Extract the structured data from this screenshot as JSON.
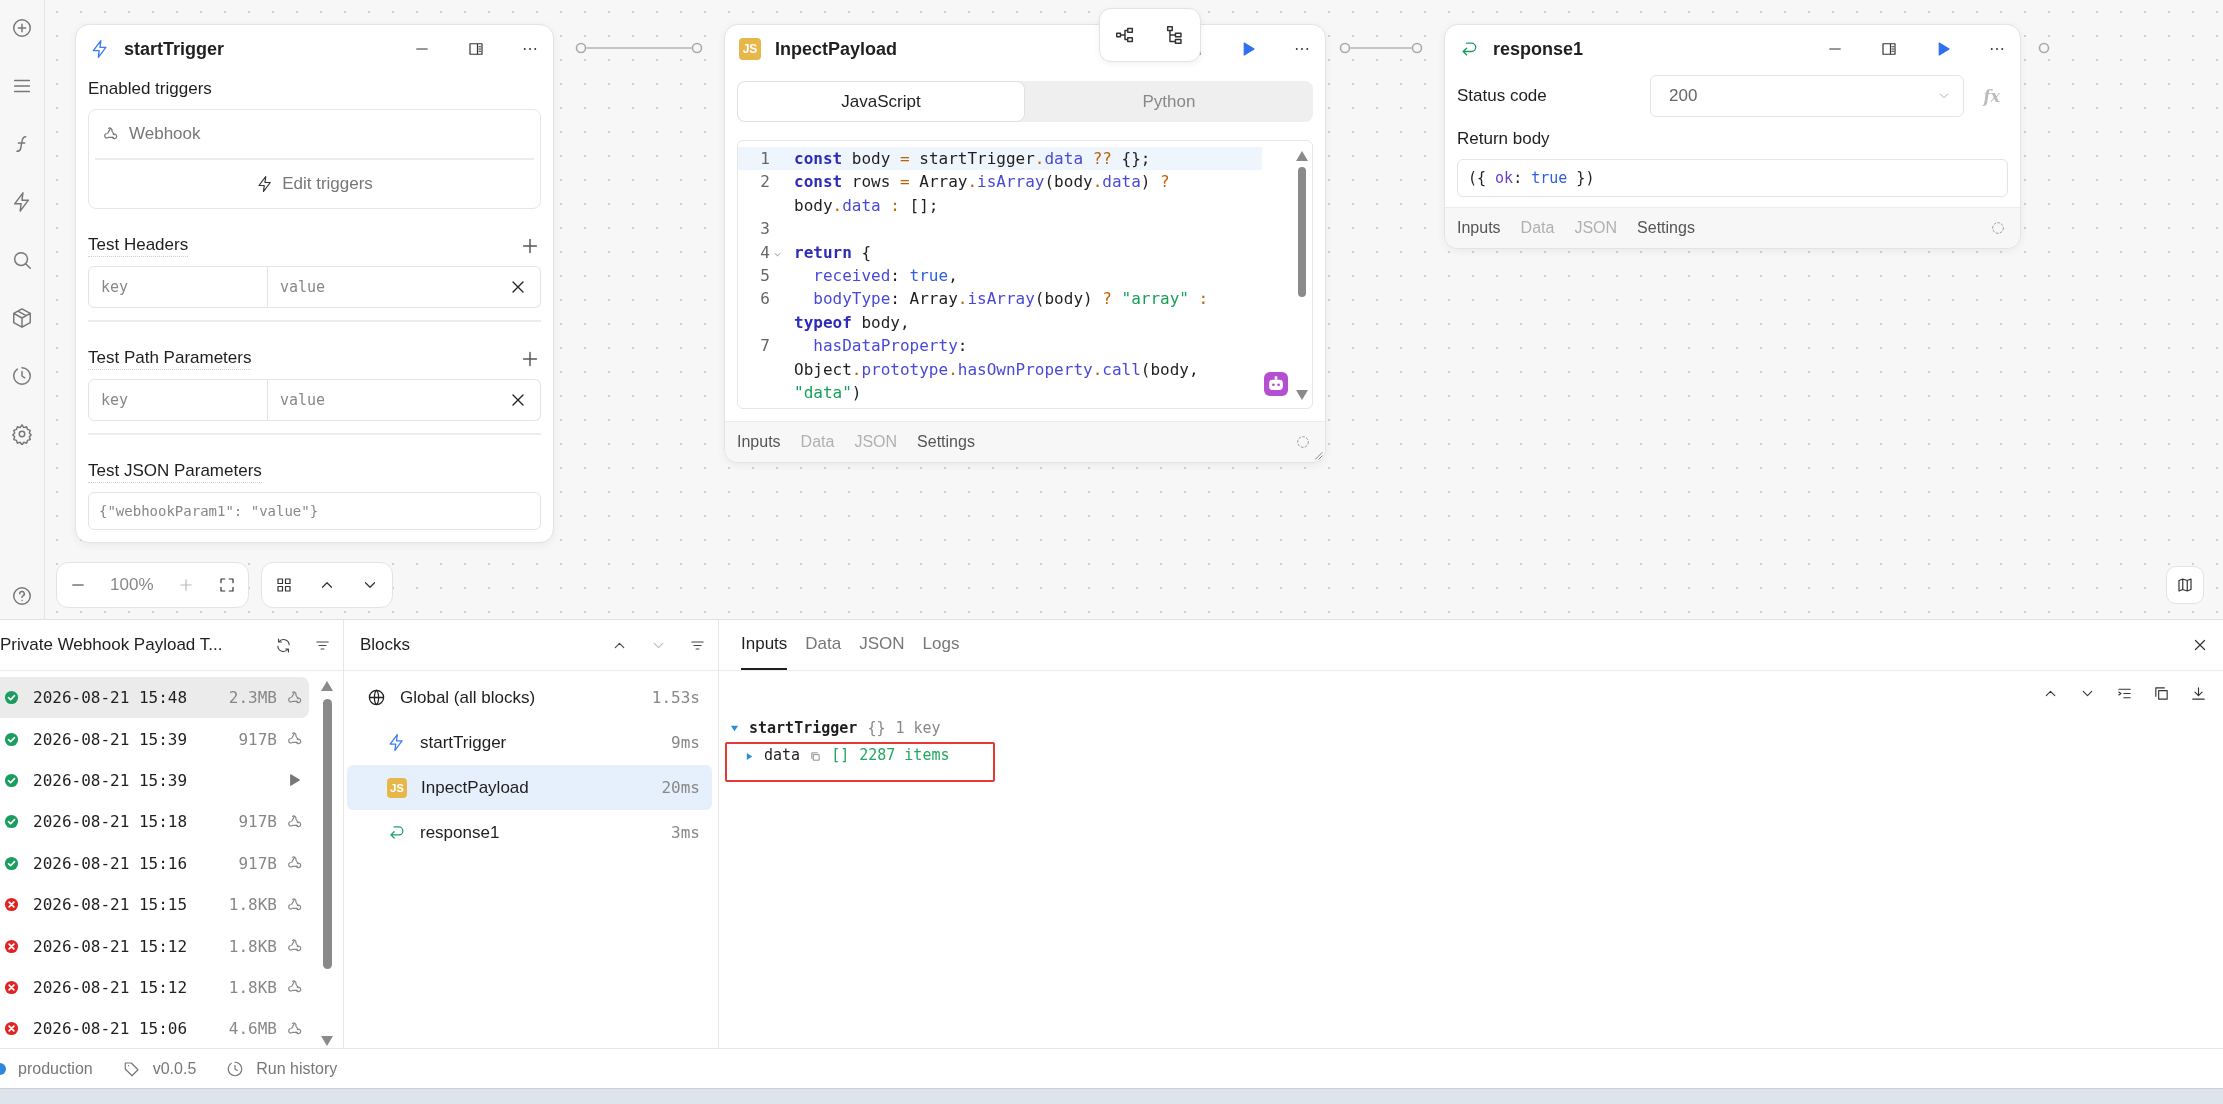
{
  "trigger_block": {
    "title": "startTrigger",
    "enabled_label": "Enabled triggers",
    "trigger": "Webhook",
    "edit_button": "Edit triggers",
    "sections": [
      {
        "title": "Test Headers",
        "key_placeholder": "key",
        "value_placeholder": "value"
      },
      {
        "title": "Test Path Parameters",
        "key_placeholder": "key",
        "value_placeholder": "value"
      }
    ],
    "json_title": "Test JSON Parameters",
    "json_placeholder": "{\"webhookParam1\": \"value\"}"
  },
  "code_block": {
    "badge": "JS",
    "title": "InpectPayload",
    "language_tabs": [
      {
        "label": "JavaScript",
        "selected": true
      },
      {
        "label": "Python",
        "selected": false
      }
    ],
    "lines": [
      {
        "number": "1",
        "fold": false,
        "active": true,
        "tokens": [
          {
            "kind": "kw",
            "text": "const"
          },
          {
            "kind": "plain",
            "text": " body "
          },
          {
            "kind": "op",
            "text": "="
          },
          {
            "kind": "plain",
            "text": " startTrigger"
          },
          {
            "kind": "op",
            "text": "."
          },
          {
            "kind": "prop",
            "text": "data"
          },
          {
            "kind": "op",
            "text": " ??"
          },
          {
            "kind": "plain",
            "text": " {};"
          }
        ]
      },
      {
        "number": "2",
        "fold": false,
        "active": false,
        "tokens": [
          {
            "kind": "kw",
            "text": "const"
          },
          {
            "kind": "plain",
            "text": " rows "
          },
          {
            "kind": "op",
            "text": "="
          },
          {
            "kind": "plain",
            "text": " Array"
          },
          {
            "kind": "op",
            "text": "."
          },
          {
            "kind": "prop",
            "text": "isArray"
          },
          {
            "kind": "plain",
            "text": "(body"
          },
          {
            "kind": "op",
            "text": "."
          },
          {
            "kind": "prop",
            "text": "data"
          },
          {
            "kind": "plain",
            "text": ")"
          },
          {
            "kind": "op",
            "text": " ?"
          },
          {
            "kind": "plain",
            "text": " body"
          },
          {
            "kind": "op",
            "text": "."
          },
          {
            "kind": "prop",
            "text": "data"
          },
          {
            "kind": "op",
            "text": " :"
          },
          {
            "kind": "plain",
            "text": " [];"
          }
        ]
      },
      {
        "number": "3",
        "fold": false,
        "active": false
      },
      {
        "number": "4",
        "fold": true,
        "active": false,
        "tokens": [
          {
            "kind": "kw",
            "text": "return"
          },
          {
            "kind": "plain",
            "text": " {"
          }
        ]
      },
      {
        "number": "5",
        "fold": false,
        "active": false,
        "tokens": [
          {
            "kind": "prop",
            "text": "  received"
          },
          {
            "kind": "plain",
            "text": ": "
          },
          {
            "kind": "lit",
            "text": "true"
          },
          {
            "kind": "plain",
            "text": ","
          }
        ]
      },
      {
        "number": "6",
        "fold": false,
        "active": false,
        "tokens": [
          {
            "kind": "prop",
            "text": "  bodyType"
          },
          {
            "kind": "plain",
            "text": ": Array"
          },
          {
            "kind": "op",
            "text": "."
          },
          {
            "kind": "prop",
            "text": "isArray"
          },
          {
            "kind": "plain",
            "text": "(body)"
          },
          {
            "kind": "op",
            "text": " ?"
          },
          {
            "kind": "str",
            "text": " \"array\""
          },
          {
            "kind": "op",
            "text": " :"
          },
          {
            "kind": "kw",
            "text": " typeof"
          },
          {
            "kind": "plain",
            "text": " body,"
          }
        ]
      },
      {
        "number": "7",
        "fold": false,
        "active": false,
        "tokens": [
          {
            "kind": "prop",
            "text": "  hasDataProperty"
          },
          {
            "kind": "plain",
            "text": ": Object"
          },
          {
            "kind": "op",
            "text": "."
          },
          {
            "kind": "prop",
            "text": "prototype"
          },
          {
            "kind": "op",
            "text": "."
          },
          {
            "kind": "prop",
            "text": "hasOwnProperty"
          },
          {
            "kind": "op",
            "text": "."
          },
          {
            "kind": "prop",
            "text": "call"
          },
          {
            "kind": "plain",
            "text": "(body, "
          },
          {
            "kind": "str",
            "text": "\"data\""
          },
          {
            "kind": "plain",
            "text": ")"
          }
        ]
      }
    ],
    "footer_tabs": [
      {
        "label": "Inputs",
        "disabled": false
      },
      {
        "label": "Data",
        "disabled": true
      },
      {
        "label": "JSON",
        "disabled": true
      },
      {
        "label": "Settings",
        "disabled": false
      }
    ]
  },
  "response_block": {
    "title": "response1",
    "status_label": "Status code",
    "status_value": "200",
    "formula_button": "fx",
    "body_label": "Return body",
    "body_tokens": [
      {
        "kind": "plain",
        "text": "({ "
      },
      {
        "kind": "key",
        "text": "ok"
      },
      {
        "kind": "plain",
        "text": ": "
      },
      {
        "kind": "lit",
        "text": "true"
      },
      {
        "kind": "plain",
        "text": " })"
      }
    ],
    "footer_tabs": [
      {
        "label": "Inputs",
        "disabled": false
      },
      {
        "label": "Data",
        "disabled": true
      },
      {
        "label": "JSON",
        "disabled": true
      },
      {
        "label": "Settings",
        "disabled": false
      }
    ]
  },
  "canvas_controls": {
    "zoom": "100%"
  },
  "runs": {
    "title": "Private Webhook Payload T...",
    "items": [
      {
        "failed": false,
        "time": "2026-08-21 15:48",
        "size": "2.3MB",
        "kind": "webhook",
        "selected": true
      },
      {
        "failed": false,
        "time": "2026-08-21 15:39",
        "size": "917B",
        "kind": "webhook",
        "selected": false
      },
      {
        "failed": false,
        "time": "2026-08-21 15:39",
        "kind": "manual",
        "selected": false
      },
      {
        "failed": false,
        "time": "2026-08-21 15:18",
        "size": "917B",
        "kind": "webhook",
        "selected": false
      },
      {
        "failed": false,
        "time": "2026-08-21 15:16",
        "size": "917B",
        "kind": "webhook",
        "selected": false
      },
      {
        "failed": true,
        "time": "2026-08-21 15:15",
        "size": "1.8KB",
        "kind": "webhook",
        "selected": false
      },
      {
        "failed": true,
        "time": "2026-08-21 15:12",
        "size": "1.8KB",
        "kind": "webhook",
        "selected": false
      },
      {
        "failed": true,
        "time": "2026-08-21 15:12",
        "size": "1.8KB",
        "kind": "webhook",
        "selected": false
      },
      {
        "failed": true,
        "time": "2026-08-21 15:06",
        "size": "4.6MB",
        "kind": "webhook",
        "selected": false
      }
    ]
  },
  "blocks": {
    "title": "Blocks",
    "items": [
      {
        "kind": "global",
        "name": "Global (all blocks)",
        "time": "1.53s",
        "selected": false,
        "children": [
          {
            "kind": "trigger",
            "name": "startTrigger",
            "time": "9ms",
            "selected": false
          },
          {
            "kind": "code",
            "badge": "JS",
            "name": "InpectPayload",
            "time": "20ms",
            "selected": true
          },
          {
            "kind": "response",
            "name": "response1",
            "time": "3ms",
            "selected": false
          }
        ]
      }
    ]
  },
  "inspector": {
    "tabs": [
      {
        "label": "Inputs",
        "selected": true
      },
      {
        "label": "Data",
        "selected": false
      },
      {
        "label": "JSON",
        "selected": false
      },
      {
        "label": "Logs",
        "selected": false
      }
    ],
    "tree": [
      {
        "key": "startTrigger",
        "expanded": true,
        "type": "{}",
        "summary": "1 key",
        "highlighted": false,
        "children": [
          {
            "key": "data",
            "expanded": false,
            "type": "[]",
            "summary": "2287 items",
            "highlighted": true,
            "copyable": true
          }
        ]
      }
    ]
  },
  "status_bar": {
    "environment": "production",
    "version": "v0.0.5",
    "history": "Run history"
  }
}
